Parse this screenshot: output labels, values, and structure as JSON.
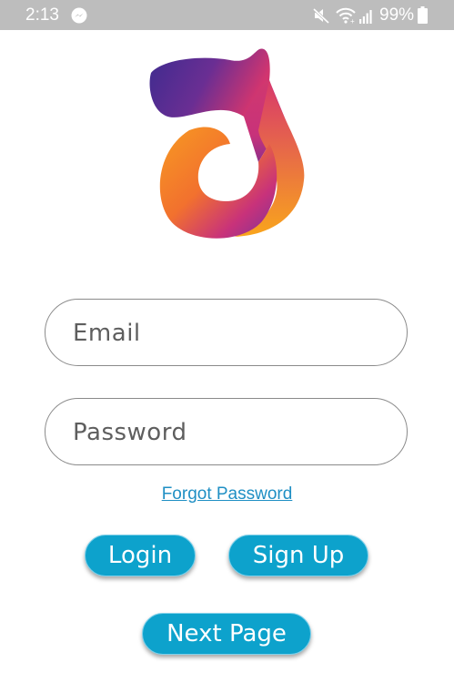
{
  "status_bar": {
    "time": "2:13",
    "battery_percent": "99%",
    "icons": [
      "messenger-icon",
      "mute-icon",
      "wifi-icon",
      "signal-icon",
      "battery-icon"
    ]
  },
  "logo": {
    "icon": "music-note-logo-icon",
    "colors": [
      "#4b2a8c",
      "#c8327a",
      "#f7a823"
    ]
  },
  "form": {
    "email_placeholder": "Email",
    "password_placeholder": "Password",
    "forgot_password_label": "Forgot Password"
  },
  "buttons": {
    "login_label": "Login",
    "signup_label": "Sign Up",
    "next_page_label": "Next Page"
  },
  "colors": {
    "button": "#0da2cc",
    "link": "#1f8fc4",
    "status_bar": "#bdbdbd"
  }
}
